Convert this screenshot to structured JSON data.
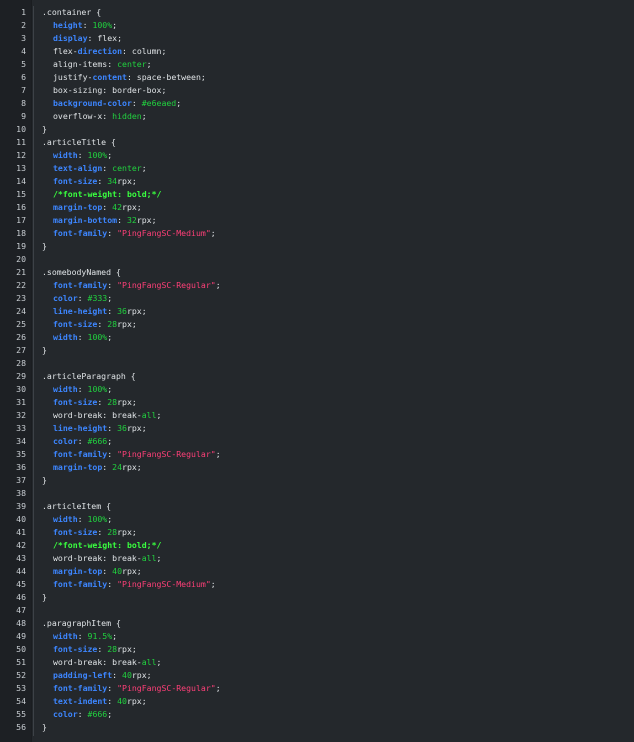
{
  "editor": {
    "language": "css",
    "colors": {
      "background": "#24282c",
      "gutter": "#1d2024",
      "property": "#3d86ff",
      "keyword_value": "#21d23f",
      "string": "#ff3f78",
      "comment": "#39ff3f",
      "text": "#dfe3e6"
    },
    "lines": [
      {
        "n": "1",
        "i": 0,
        "t": [
          [
            "p",
            ".container {"
          ]
        ]
      },
      {
        "n": "2",
        "i": 1,
        "t": [
          [
            "k",
            "height"
          ],
          [
            "p",
            ": "
          ],
          [
            "v",
            "100%"
          ],
          [
            "p",
            ";"
          ]
        ]
      },
      {
        "n": "3",
        "i": 1,
        "t": [
          [
            "k",
            "display"
          ],
          [
            "p",
            ": flex;"
          ]
        ]
      },
      {
        "n": "4",
        "i": 1,
        "t": [
          [
            "p",
            "flex-"
          ],
          [
            "k",
            "direction"
          ],
          [
            "p",
            ": column;"
          ]
        ]
      },
      {
        "n": "5",
        "i": 1,
        "t": [
          [
            "p",
            "align-items: "
          ],
          [
            "v",
            "center"
          ],
          [
            "p",
            ";"
          ]
        ]
      },
      {
        "n": "6",
        "i": 1,
        "t": [
          [
            "p",
            "justify-"
          ],
          [
            "k",
            "content"
          ],
          [
            "p",
            ": space-between;"
          ]
        ]
      },
      {
        "n": "7",
        "i": 1,
        "t": [
          [
            "p",
            "box-sizing: border-box;"
          ]
        ]
      },
      {
        "n": "8",
        "i": 1,
        "t": [
          [
            "k",
            "background-color"
          ],
          [
            "p",
            ": "
          ],
          [
            "v",
            "#e6eaed"
          ],
          [
            "p",
            ";"
          ]
        ]
      },
      {
        "n": "9",
        "i": 1,
        "t": [
          [
            "p",
            "overflow-x: "
          ],
          [
            "v",
            "hidden"
          ],
          [
            "p",
            ";"
          ]
        ]
      },
      {
        "n": "10",
        "i": 0,
        "t": [
          [
            "p",
            "}"
          ]
        ]
      },
      {
        "n": "11",
        "i": 0,
        "t": [
          [
            "p",
            ".articleTitle {"
          ]
        ]
      },
      {
        "n": "12",
        "i": 1,
        "t": [
          [
            "k",
            "width"
          ],
          [
            "p",
            ": "
          ],
          [
            "v",
            "100%"
          ],
          [
            "p",
            ";"
          ]
        ]
      },
      {
        "n": "13",
        "i": 1,
        "t": [
          [
            "k",
            "text-align"
          ],
          [
            "p",
            ": "
          ],
          [
            "v",
            "center"
          ],
          [
            "p",
            ";"
          ]
        ]
      },
      {
        "n": "14",
        "i": 1,
        "t": [
          [
            "k",
            "font-size"
          ],
          [
            "p",
            ": "
          ],
          [
            "v",
            "34"
          ],
          [
            "p",
            "rpx;"
          ]
        ]
      },
      {
        "n": "15",
        "i": 1,
        "t": [
          [
            "c",
            "/*font-weight: bold;*/"
          ]
        ]
      },
      {
        "n": "16",
        "i": 1,
        "t": [
          [
            "k",
            "margin-top"
          ],
          [
            "p",
            ": "
          ],
          [
            "v",
            "42"
          ],
          [
            "p",
            "rpx;"
          ]
        ]
      },
      {
        "n": "17",
        "i": 1,
        "t": [
          [
            "k",
            "margin-bottom"
          ],
          [
            "p",
            ": "
          ],
          [
            "v",
            "32"
          ],
          [
            "p",
            "rpx;"
          ]
        ]
      },
      {
        "n": "18",
        "i": 1,
        "t": [
          [
            "k",
            "font-family"
          ],
          [
            "p",
            ": "
          ],
          [
            "s",
            "\"PingFangSC-Medium\""
          ],
          [
            "p",
            ";"
          ]
        ]
      },
      {
        "n": "19",
        "i": 0,
        "t": [
          [
            "p",
            "}"
          ]
        ]
      },
      {
        "n": "20",
        "i": 0,
        "t": []
      },
      {
        "n": "21",
        "i": 0,
        "t": [
          [
            "p",
            ".somebodyNamed {"
          ]
        ]
      },
      {
        "n": "22",
        "i": 1,
        "t": [
          [
            "k",
            "font-family"
          ],
          [
            "p",
            ": "
          ],
          [
            "s",
            "\"PingFangSC-Regular\""
          ],
          [
            "p",
            ";"
          ]
        ]
      },
      {
        "n": "23",
        "i": 1,
        "t": [
          [
            "k",
            "color"
          ],
          [
            "p",
            ": "
          ],
          [
            "v",
            "#333"
          ],
          [
            "p",
            ";"
          ]
        ]
      },
      {
        "n": "24",
        "i": 1,
        "t": [
          [
            "k",
            "line-height"
          ],
          [
            "p",
            ": "
          ],
          [
            "v",
            "36"
          ],
          [
            "p",
            "rpx;"
          ]
        ]
      },
      {
        "n": "25",
        "i": 1,
        "t": [
          [
            "k",
            "font-size"
          ],
          [
            "p",
            ": "
          ],
          [
            "v",
            "28"
          ],
          [
            "p",
            "rpx;"
          ]
        ]
      },
      {
        "n": "26",
        "i": 1,
        "t": [
          [
            "k",
            "width"
          ],
          [
            "p",
            ": "
          ],
          [
            "v",
            "100%"
          ],
          [
            "p",
            ";"
          ]
        ]
      },
      {
        "n": "27",
        "i": 0,
        "t": [
          [
            "p",
            "}"
          ]
        ]
      },
      {
        "n": "28",
        "i": 0,
        "t": []
      },
      {
        "n": "29",
        "i": 0,
        "t": [
          [
            "p",
            ".articleParagraph {"
          ]
        ]
      },
      {
        "n": "30",
        "i": 1,
        "t": [
          [
            "k",
            "width"
          ],
          [
            "p",
            ": "
          ],
          [
            "v",
            "100%"
          ],
          [
            "p",
            ";"
          ]
        ]
      },
      {
        "n": "31",
        "i": 1,
        "t": [
          [
            "k",
            "font-size"
          ],
          [
            "p",
            ": "
          ],
          [
            "v",
            "28"
          ],
          [
            "p",
            "rpx;"
          ]
        ]
      },
      {
        "n": "32",
        "i": 1,
        "t": [
          [
            "p",
            "word-break: break-"
          ],
          [
            "v",
            "all"
          ],
          [
            "p",
            ";"
          ]
        ]
      },
      {
        "n": "33",
        "i": 1,
        "t": [
          [
            "k",
            "line-height"
          ],
          [
            "p",
            ": "
          ],
          [
            "v",
            "36"
          ],
          [
            "p",
            "rpx;"
          ]
        ]
      },
      {
        "n": "34",
        "i": 1,
        "t": [
          [
            "k",
            "color"
          ],
          [
            "p",
            ": "
          ],
          [
            "v",
            "#666"
          ],
          [
            "p",
            ";"
          ]
        ]
      },
      {
        "n": "35",
        "i": 1,
        "t": [
          [
            "k",
            "font-family"
          ],
          [
            "p",
            ": "
          ],
          [
            "s",
            "\"PingFangSC-Regular\""
          ],
          [
            "p",
            ";"
          ]
        ]
      },
      {
        "n": "36",
        "i": 1,
        "t": [
          [
            "k",
            "margin-top"
          ],
          [
            "p",
            ": "
          ],
          [
            "v",
            "24"
          ],
          [
            "p",
            "rpx;"
          ]
        ]
      },
      {
        "n": "37",
        "i": 0,
        "t": [
          [
            "p",
            "}"
          ]
        ]
      },
      {
        "n": "38",
        "i": 0,
        "t": []
      },
      {
        "n": "39",
        "i": 0,
        "t": [
          [
            "p",
            ".articleItem {"
          ]
        ]
      },
      {
        "n": "40",
        "i": 1,
        "t": [
          [
            "k",
            "width"
          ],
          [
            "p",
            ": "
          ],
          [
            "v",
            "100%"
          ],
          [
            "p",
            ";"
          ]
        ]
      },
      {
        "n": "41",
        "i": 1,
        "t": [
          [
            "k",
            "font-size"
          ],
          [
            "p",
            ": "
          ],
          [
            "v",
            "28"
          ],
          [
            "p",
            "rpx;"
          ]
        ]
      },
      {
        "n": "42",
        "i": 1,
        "t": [
          [
            "c",
            "/*font-weight: bold;*/"
          ]
        ]
      },
      {
        "n": "43",
        "i": 1,
        "t": [
          [
            "p",
            "word-break: break-"
          ],
          [
            "v",
            "all"
          ],
          [
            "p",
            ";"
          ]
        ]
      },
      {
        "n": "44",
        "i": 1,
        "t": [
          [
            "k",
            "margin-top"
          ],
          [
            "p",
            ": "
          ],
          [
            "v",
            "40"
          ],
          [
            "p",
            "rpx;"
          ]
        ]
      },
      {
        "n": "45",
        "i": 1,
        "t": [
          [
            "k",
            "font-family"
          ],
          [
            "p",
            ": "
          ],
          [
            "s",
            "\"PingFangSC-Medium\""
          ],
          [
            "p",
            ";"
          ]
        ]
      },
      {
        "n": "46",
        "i": 0,
        "t": [
          [
            "p",
            "}"
          ]
        ]
      },
      {
        "n": "47",
        "i": 0,
        "t": []
      },
      {
        "n": "48",
        "i": 0,
        "t": [
          [
            "p",
            ".paragraphItem {"
          ]
        ]
      },
      {
        "n": "49",
        "i": 1,
        "t": [
          [
            "k",
            "width"
          ],
          [
            "p",
            ": "
          ],
          [
            "v",
            "91.5%"
          ],
          [
            "p",
            ";"
          ]
        ]
      },
      {
        "n": "50",
        "i": 1,
        "t": [
          [
            "k",
            "font-size"
          ],
          [
            "p",
            ": "
          ],
          [
            "v",
            "28"
          ],
          [
            "p",
            "rpx;"
          ]
        ]
      },
      {
        "n": "51",
        "i": 1,
        "t": [
          [
            "p",
            "word-break: break-"
          ],
          [
            "v",
            "all"
          ],
          [
            "p",
            ";"
          ]
        ]
      },
      {
        "n": "52",
        "i": 1,
        "t": [
          [
            "k",
            "padding-left"
          ],
          [
            "p",
            ": "
          ],
          [
            "v",
            "40"
          ],
          [
            "p",
            "rpx;"
          ]
        ]
      },
      {
        "n": "53",
        "i": 1,
        "t": [
          [
            "k",
            "font-family"
          ],
          [
            "p",
            ": "
          ],
          [
            "s",
            "\"PingFangSC-Regular\""
          ],
          [
            "p",
            ";"
          ]
        ]
      },
      {
        "n": "54",
        "i": 1,
        "t": [
          [
            "k",
            "text-indent"
          ],
          [
            "p",
            ": "
          ],
          [
            "v",
            "40"
          ],
          [
            "p",
            "rpx;"
          ]
        ]
      },
      {
        "n": "55",
        "i": 1,
        "t": [
          [
            "k",
            "color"
          ],
          [
            "p",
            ": "
          ],
          [
            "v",
            "#666"
          ],
          [
            "p",
            ";"
          ]
        ]
      },
      {
        "n": "56",
        "i": 0,
        "t": [
          [
            "p",
            "}"
          ]
        ]
      }
    ]
  }
}
